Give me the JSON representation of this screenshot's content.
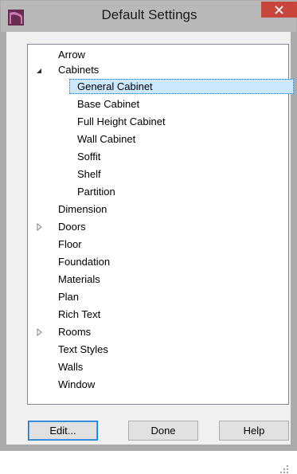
{
  "window": {
    "title": "Default Settings"
  },
  "tree": {
    "items": [
      {
        "label": "Arrow"
      },
      {
        "label": "Cabinets",
        "expander": "expanded"
      },
      {
        "label": "General Cabinet",
        "selected": true
      },
      {
        "label": "Base Cabinet"
      },
      {
        "label": "Full Height Cabinet"
      },
      {
        "label": "Wall Cabinet"
      },
      {
        "label": "Soffit"
      },
      {
        "label": "Shelf"
      },
      {
        "label": "Partition"
      },
      {
        "label": "Dimension"
      },
      {
        "label": "Doors",
        "expander": "collapsed"
      },
      {
        "label": "Floor"
      },
      {
        "label": "Foundation"
      },
      {
        "label": "Materials"
      },
      {
        "label": "Plan"
      },
      {
        "label": "Rich Text"
      },
      {
        "label": "Rooms",
        "expander": "collapsed"
      },
      {
        "label": "Text Styles"
      },
      {
        "label": "Walls"
      },
      {
        "label": "Window"
      }
    ]
  },
  "buttons": {
    "edit": "Edit...",
    "done": "Done",
    "help": "Help"
  },
  "icons": {
    "app": "app-logo-icon",
    "close": "close-icon",
    "expanded": "expanded-triangle-icon",
    "collapsed": "collapsed-triangle-icon",
    "grip": "resize-grip-icon"
  },
  "colors": {
    "selection_fill": "#cce8ff",
    "selection_border": "#1b6bb5",
    "close_button": "#c9463d",
    "app_icon": "#6b2a4f"
  }
}
